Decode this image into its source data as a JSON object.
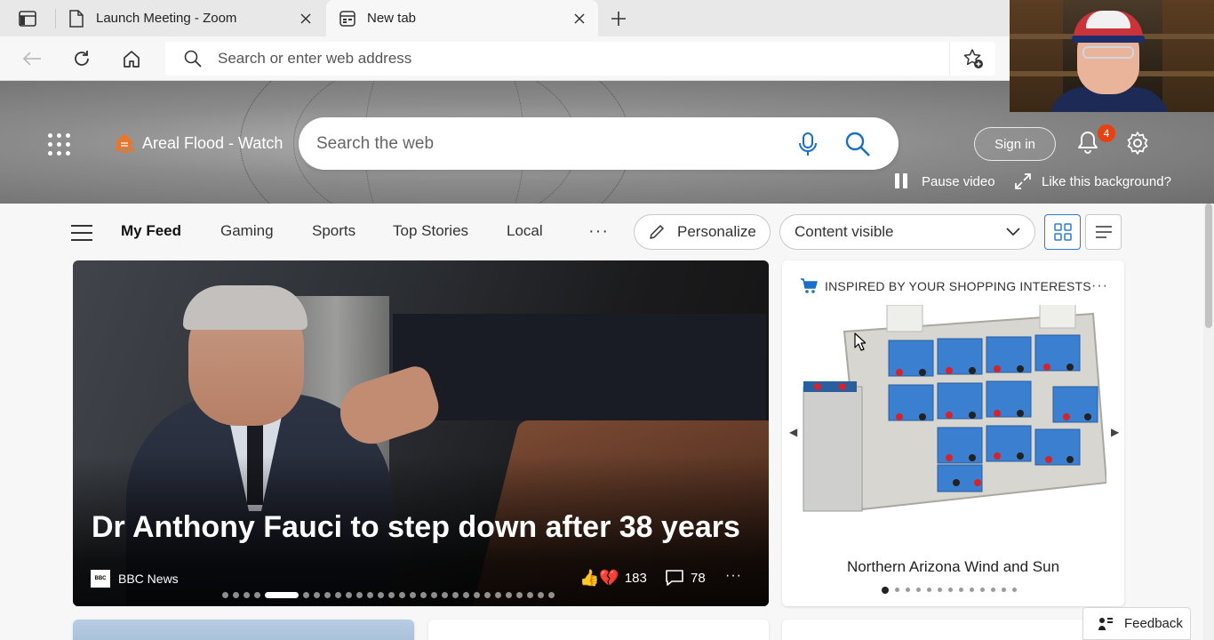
{
  "browser": {
    "tabs": [
      {
        "title": "Launch Meeting - Zoom"
      },
      {
        "title": "New tab"
      }
    ],
    "address_placeholder": "Search or enter web address"
  },
  "hero": {
    "weather_label": "Areal Flood - Watch",
    "search_placeholder": "Search the web",
    "sign_in_label": "Sign in",
    "notification_count": "4",
    "pause_video_label": "Pause video",
    "like_background_label": "Like this background?"
  },
  "feed_nav": {
    "items": [
      "My Feed",
      "Gaming",
      "Sports",
      "Top Stories",
      "Local"
    ],
    "more_label": "···",
    "personalize_label": "Personalize",
    "content_select_value": "Content visible"
  },
  "main_story": {
    "headline": "Dr Anthony Fauci to step down after 38 years",
    "source": "BBC News",
    "source_logo_text": "BBC",
    "reaction_emoji": "👍💔",
    "reaction_count": "183",
    "comment_count": "78",
    "more_label": "···",
    "carousel_total": 29,
    "carousel_active": 4
  },
  "shopping_card": {
    "header": "INSPIRED BY YOUR SHOPPING INTERESTS",
    "more_label": "···",
    "product_title": "Northern Arizona Wind and Sun",
    "carousel_total": 13,
    "carousel_active": 0,
    "prev_arrow": "◀",
    "next_arrow": "▶"
  },
  "feedback_label": "Feedback",
  "colors": {
    "accent_blue": "#2b7bd6",
    "badge_red": "#e8410f",
    "battery_blue": "#3a7fd0"
  }
}
